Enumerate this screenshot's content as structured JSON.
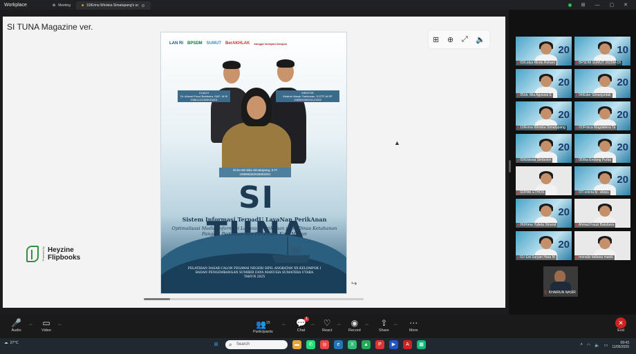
{
  "window": {
    "app_name": "Workplace"
  },
  "tabs": [
    {
      "label": "Meeting",
      "active": false
    },
    {
      "label": "10/Erina Winiska Simatupang's sc",
      "active": true
    }
  ],
  "shared_content": {
    "title": "SI TUNA Magazine ver.",
    "brand_line1": "Heyzine",
    "brand_line2": "Flipbooks",
    "brand_vertical": "Powered by"
  },
  "poster": {
    "logos": [
      "LAN RI",
      "BPSDM",
      "SUMUT",
      "BerAKHLAK",
      "bangga melayani bangsa"
    ],
    "coach_role": "COACH",
    "coach_name": "Dr. Ahmad Fauzi Batubara, SAP., M.Si",
    "coach_nip": "198611122005021001",
    "mentor_role": "MENTOR",
    "mentor_name": "Khairun Nasyir Tambunan, S.STP.,M.SP",
    "mentor_nip": "198309052001121002",
    "participant_name": "Erina Winiska Simatupang, S.Pi",
    "participant_nip": "199906262025052001",
    "title": "SI TUNA",
    "subtitle": "Sistem Informasi TerpadU LayaNan PerikAnan",
    "description": "Optimalisasi Media Informasi Layanan Perikanan pada Dinas Ketahanan Pangan, Pertanian dan Perikanan Kota Medan",
    "footer_line1": "PELATIHAN DASAR CALON PEGAWAI NEGERI SIPIL ANGKATAN XX KELOMPOK I",
    "footer_line2": "BADAN PENGEMBANGAN SUMBER DAYA MANUSIA SUMATERA UTARA",
    "footer_line3": "TAHUN 2025"
  },
  "gallery": [
    {
      "name": "03/Lidya Rindu Rohani",
      "num": "20"
    },
    {
      "name": "BPSDM SUMUT 2025M-19",
      "num": "10"
    },
    {
      "name": "05/dr. Mia Agnesia E",
      "num": "20"
    },
    {
      "name": "04/Eder Simanjuntak",
      "num": "20"
    },
    {
      "name": "10/Erina Winiska Simatupang",
      "num": "20"
    },
    {
      "name": "01/Frisca Magdalena Ta",
      "num": "20"
    },
    {
      "name": "09/Eklesia Simbolon",
      "num": "20"
    },
    {
      "name": "05/Ika Endang Purba",
      "num": "20"
    },
    {
      "name": "02/PAK ETHOS",
      "num": ""
    },
    {
      "name": "07/ eninta br. sitepu",
      "num": "20"
    },
    {
      "name": "06/Rima Yulieta Sinurat",
      "num": "20"
    },
    {
      "name": "Ahmad Fauzi Batubara",
      "num": ""
    },
    {
      "name": "01/ Edi Suryan Hara M",
      "num": "20"
    },
    {
      "name": "monalis fattiana manik",
      "num": ""
    }
  ],
  "solo": {
    "name": "KHAIRUN NASIR"
  },
  "toolbar": {
    "audio": "Audio",
    "video": "Video",
    "participants": "Participants",
    "participants_count": "15",
    "chat": "Chat",
    "chat_badge": "1",
    "react": "React",
    "record": "Record",
    "share": "Share",
    "more": "More",
    "end": "End"
  },
  "taskbar": {
    "temp": "27°C",
    "search_placeholder": "Search",
    "time": "09:43",
    "date": "11/05/2025"
  },
  "colors": {
    "accent": "#2c7fa6",
    "end": "#cc2222",
    "brand_green": "#2f8f3f"
  }
}
